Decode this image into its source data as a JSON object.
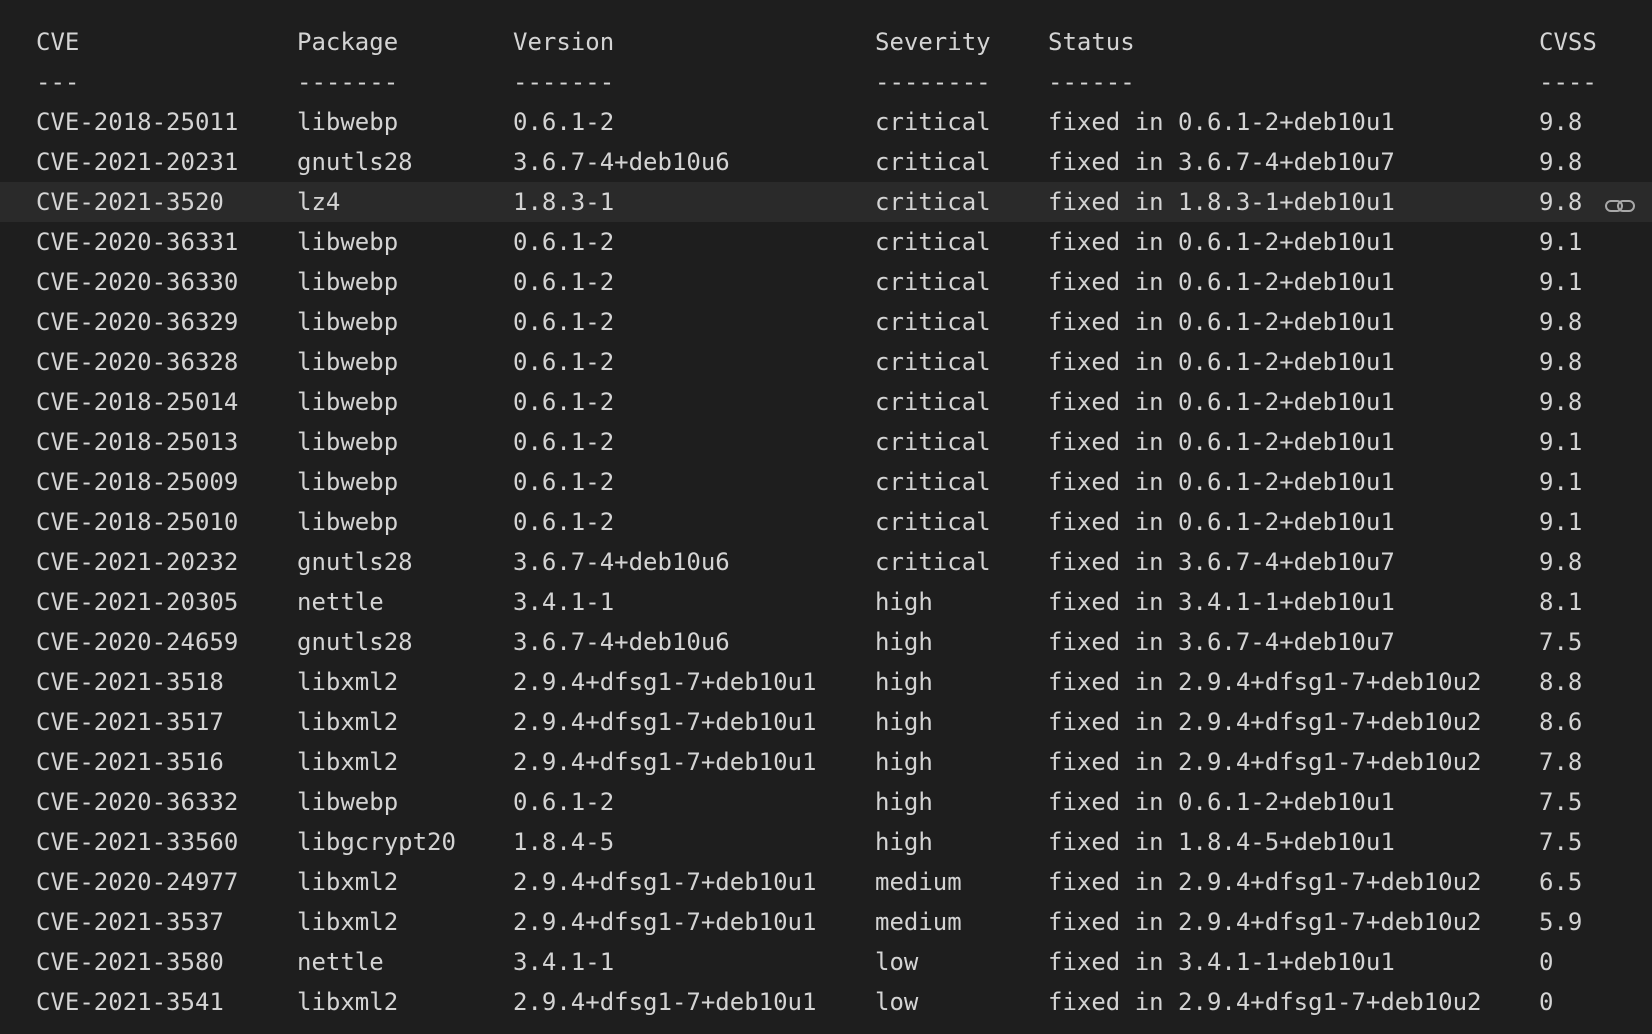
{
  "table": {
    "headers": {
      "cve": "CVE",
      "package": "Package",
      "version": "Version",
      "severity": "Severity",
      "status": "Status",
      "cvss": "CVSS"
    },
    "separators": {
      "cve": "---",
      "package": "-------",
      "version": "-------",
      "severity": "--------",
      "status": "------",
      "cvss": "----"
    },
    "highlighted_row": 2,
    "highlight_icon": "link-icon",
    "rows": [
      {
        "cve": "CVE-2018-25011",
        "package": "libwebp",
        "version": "0.6.1-2",
        "severity": "critical",
        "status": "fixed in 0.6.1-2+deb10u1",
        "cvss": "9.8"
      },
      {
        "cve": "CVE-2021-20231",
        "package": "gnutls28",
        "version": "3.6.7-4+deb10u6",
        "severity": "critical",
        "status": "fixed in 3.6.7-4+deb10u7",
        "cvss": "9.8"
      },
      {
        "cve": "CVE-2021-3520",
        "package": "lz4",
        "version": "1.8.3-1",
        "severity": "critical",
        "status": "fixed in 1.8.3-1+deb10u1",
        "cvss": "9.8"
      },
      {
        "cve": "CVE-2020-36331",
        "package": "libwebp",
        "version": "0.6.1-2",
        "severity": "critical",
        "status": "fixed in 0.6.1-2+deb10u1",
        "cvss": "9.1"
      },
      {
        "cve": "CVE-2020-36330",
        "package": "libwebp",
        "version": "0.6.1-2",
        "severity": "critical",
        "status": "fixed in 0.6.1-2+deb10u1",
        "cvss": "9.1"
      },
      {
        "cve": "CVE-2020-36329",
        "package": "libwebp",
        "version": "0.6.1-2",
        "severity": "critical",
        "status": "fixed in 0.6.1-2+deb10u1",
        "cvss": "9.8"
      },
      {
        "cve": "CVE-2020-36328",
        "package": "libwebp",
        "version": "0.6.1-2",
        "severity": "critical",
        "status": "fixed in 0.6.1-2+deb10u1",
        "cvss": "9.8"
      },
      {
        "cve": "CVE-2018-25014",
        "package": "libwebp",
        "version": "0.6.1-2",
        "severity": "critical",
        "status": "fixed in 0.6.1-2+deb10u1",
        "cvss": "9.8"
      },
      {
        "cve": "CVE-2018-25013",
        "package": "libwebp",
        "version": "0.6.1-2",
        "severity": "critical",
        "status": "fixed in 0.6.1-2+deb10u1",
        "cvss": "9.1"
      },
      {
        "cve": "CVE-2018-25009",
        "package": "libwebp",
        "version": "0.6.1-2",
        "severity": "critical",
        "status": "fixed in 0.6.1-2+deb10u1",
        "cvss": "9.1"
      },
      {
        "cve": "CVE-2018-25010",
        "package": "libwebp",
        "version": "0.6.1-2",
        "severity": "critical",
        "status": "fixed in 0.6.1-2+deb10u1",
        "cvss": "9.1"
      },
      {
        "cve": "CVE-2021-20232",
        "package": "gnutls28",
        "version": "3.6.7-4+deb10u6",
        "severity": "critical",
        "status": "fixed in 3.6.7-4+deb10u7",
        "cvss": "9.8"
      },
      {
        "cve": "CVE-2021-20305",
        "package": "nettle",
        "version": "3.4.1-1",
        "severity": "high",
        "status": "fixed in 3.4.1-1+deb10u1",
        "cvss": "8.1"
      },
      {
        "cve": "CVE-2020-24659",
        "package": "gnutls28",
        "version": "3.6.7-4+deb10u6",
        "severity": "high",
        "status": "fixed in 3.6.7-4+deb10u7",
        "cvss": "7.5"
      },
      {
        "cve": "CVE-2021-3518",
        "package": "libxml2",
        "version": "2.9.4+dfsg1-7+deb10u1",
        "severity": "high",
        "status": "fixed in 2.9.4+dfsg1-7+deb10u2",
        "cvss": "8.8"
      },
      {
        "cve": "CVE-2021-3517",
        "package": "libxml2",
        "version": "2.9.4+dfsg1-7+deb10u1",
        "severity": "high",
        "status": "fixed in 2.9.4+dfsg1-7+deb10u2",
        "cvss": "8.6"
      },
      {
        "cve": "CVE-2021-3516",
        "package": "libxml2",
        "version": "2.9.4+dfsg1-7+deb10u1",
        "severity": "high",
        "status": "fixed in 2.9.4+dfsg1-7+deb10u2",
        "cvss": "7.8"
      },
      {
        "cve": "CVE-2020-36332",
        "package": "libwebp",
        "version": "0.6.1-2",
        "severity": "high",
        "status": "fixed in 0.6.1-2+deb10u1",
        "cvss": "7.5"
      },
      {
        "cve": "CVE-2021-33560",
        "package": "libgcrypt20",
        "version": "1.8.4-5",
        "severity": "high",
        "status": "fixed in 1.8.4-5+deb10u1",
        "cvss": "7.5"
      },
      {
        "cve": "CVE-2020-24977",
        "package": "libxml2",
        "version": "2.9.4+dfsg1-7+deb10u1",
        "severity": "medium",
        "status": "fixed in 2.9.4+dfsg1-7+deb10u2",
        "cvss": "6.5"
      },
      {
        "cve": "CVE-2021-3537",
        "package": "libxml2",
        "version": "2.9.4+dfsg1-7+deb10u1",
        "severity": "medium",
        "status": "fixed in 2.9.4+dfsg1-7+deb10u2",
        "cvss": "5.9"
      },
      {
        "cve": "CVE-2021-3580",
        "package": "nettle",
        "version": "3.4.1-1",
        "severity": "low",
        "status": "fixed in 3.4.1-1+deb10u1",
        "cvss": "0"
      },
      {
        "cve": "CVE-2021-3541",
        "package": "libxml2",
        "version": "2.9.4+dfsg1-7+deb10u1",
        "severity": "low",
        "status": "fixed in 2.9.4+dfsg1-7+deb10u2",
        "cvss": "0"
      }
    ]
  },
  "colors": {
    "background": "#1e1e1e",
    "text": "#d4d4d4",
    "highlight": "#2a2a2a",
    "icon": "#a8a8a8"
  }
}
